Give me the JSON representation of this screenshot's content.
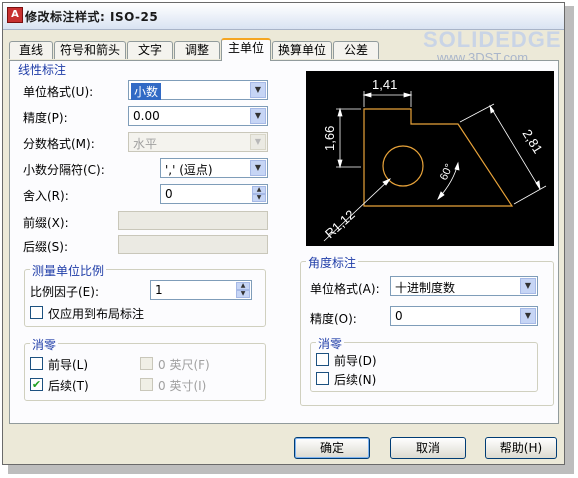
{
  "window": {
    "title": "修改标注样式: ISO-25",
    "icon_text": "A"
  },
  "watermark": {
    "line1": "SOLIDEDGE",
    "line2": "www.3DST.com"
  },
  "tabs": [
    {
      "label": "直线"
    },
    {
      "label": "符号和箭头"
    },
    {
      "label": "文字"
    },
    {
      "label": "调整"
    },
    {
      "label": "主单位",
      "active": true
    },
    {
      "label": "换算单位"
    },
    {
      "label": "公差"
    }
  ],
  "linear": {
    "group_title": "线性标注",
    "unit_format_label": "单位格式(U):",
    "unit_format_value": "小数",
    "precision_label": "精度(P):",
    "precision_value": "0.00",
    "fraction_format_label": "分数格式(M):",
    "fraction_format_value": "水平",
    "decimal_sep_label": "小数分隔符(C):",
    "decimal_sep_value": "',' (逗点)",
    "round_label": "舍入(R):",
    "round_value": "0",
    "prefix_label": "前缀(X):",
    "prefix_value": "",
    "suffix_label": "后缀(S):",
    "suffix_value": ""
  },
  "scale": {
    "group_title": "测量单位比例",
    "factor_label": "比例因子(E):",
    "factor_value": "1",
    "layout_only_label": "仅应用到布局标注",
    "layout_only_checked": false
  },
  "zero_linear": {
    "group_title": "消零",
    "leading_label": "前导(L)",
    "leading_checked": false,
    "trailing_label": "后续(T)",
    "trailing_checked": true,
    "feet_label": "0 英尺(F)",
    "inches_label": "0 英寸(I)"
  },
  "angular": {
    "group_title": "角度标注",
    "unit_format_label": "单位格式(A):",
    "unit_format_value": "十进制度数",
    "precision_label": "精度(O):",
    "precision_value": "0"
  },
  "zero_angular": {
    "group_title": "消零",
    "leading_label": "前导(D)",
    "leading_checked": false,
    "trailing_label": "后续(N)",
    "trailing_checked": false
  },
  "preview": {
    "dims": {
      "top": "1,41",
      "left": "1,66",
      "right": "2,81",
      "angle": "60°",
      "radius": "R1,12"
    },
    "colors": {
      "background": "#000000",
      "geometry": "#e8a33a",
      "dimension": "#ffffff"
    }
  },
  "buttons": {
    "ok": "确定",
    "cancel": "取消",
    "help": "帮助(H)"
  },
  "icons": {
    "dropdown": "chevron-down-icon",
    "check": "checkmark-icon"
  }
}
